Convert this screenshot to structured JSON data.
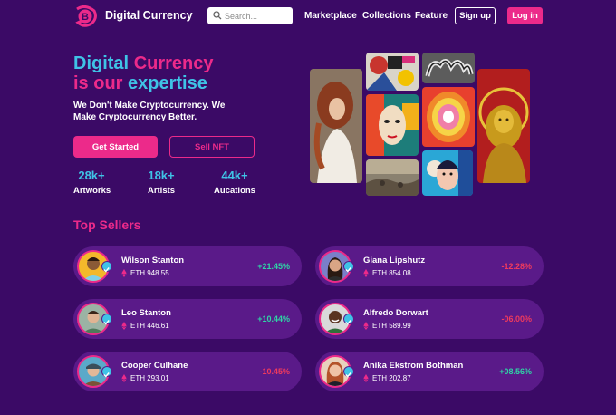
{
  "nav": {
    "brand": "Digital Currency",
    "search_placeholder": "Search...",
    "links": [
      "Marketplace",
      "Collections",
      "Feature"
    ],
    "signup": "Sign up",
    "login": "Log in"
  },
  "hero": {
    "title_line1_a": "Digital",
    "title_line1_b": "Currency",
    "title_line2_a": "is our",
    "title_line2_b": "expertise",
    "tagline": "We Don't Make Cryptocurrency. We Make Cryptocurrency Better.",
    "get_started": "Get Started",
    "sell_nft": "Sell NFT",
    "stats": [
      {
        "value": "28k+",
        "label": "Artworks"
      },
      {
        "value": "18k+",
        "label": "Artists"
      },
      {
        "value": "44k+",
        "label": "Aucations"
      }
    ]
  },
  "sellers_title": "Top Sellers",
  "sellers": [
    {
      "name": "Wilson Stanton",
      "eth": "ETH 948.55",
      "change": "+21.45%"
    },
    {
      "name": "Giana Lipshutz",
      "eth": "ETH 854.08",
      "change": "-12.28%"
    },
    {
      "name": "Leo Stanton",
      "eth": "ETH 446.61",
      "change": "+10.44%"
    },
    {
      "name": "Alfredo Dorwart",
      "eth": "ETH 589.99",
      "change": "-06.00%"
    },
    {
      "name": "Cooper Culhane",
      "eth": "ETH 293.01",
      "change": "-10.45%"
    },
    {
      "name": "Anika Ekstrom Bothman",
      "eth": "ETH 202.87",
      "change": "+08.56%"
    }
  ],
  "colors": {
    "background": "#3b0a66",
    "accent": "#ec2a8a",
    "cyan": "#3fc3e6",
    "positive": "#2fd4a6",
    "negative": "#ef3a5d"
  }
}
